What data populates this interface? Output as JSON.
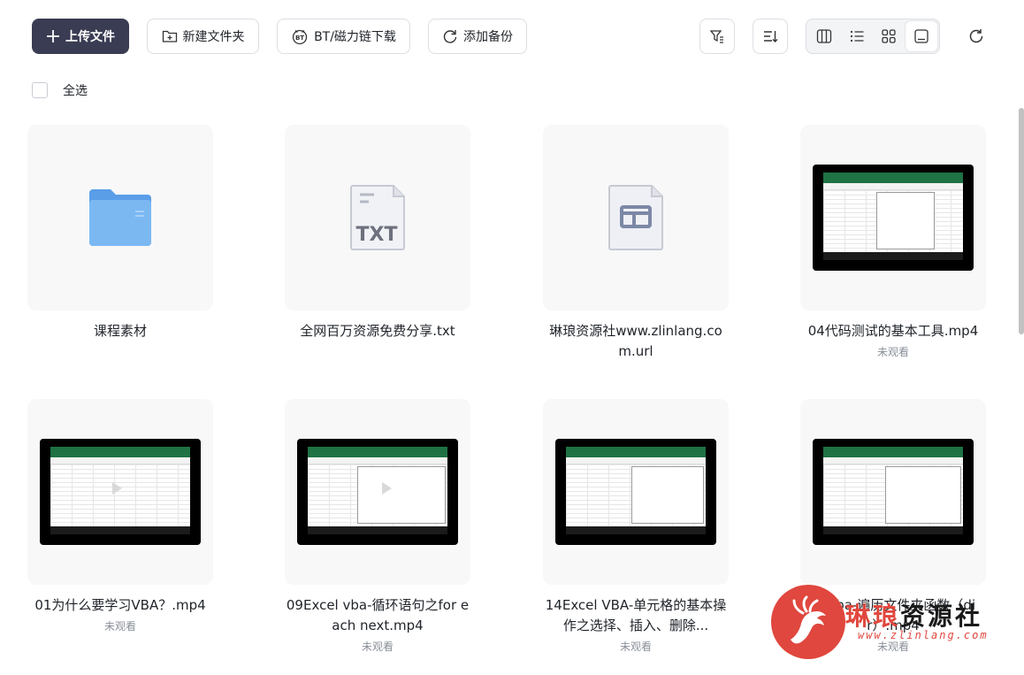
{
  "toolbar": {
    "upload_label": "上传文件",
    "new_folder_label": "新建文件夹",
    "bt_download_label": "BT/磁力链下载",
    "add_backup_label": "添加备份",
    "filter_icon": "filter-icon",
    "sort_icon": "sort-icon",
    "refresh_icon": "refresh-icon",
    "view_modes": [
      "columns-view",
      "list-view",
      "grid-view",
      "large-thumb-view"
    ],
    "active_view": "large-thumb-view"
  },
  "select_all_label": "全选",
  "files": [
    {
      "name": "课程素材",
      "type": "folder",
      "status": ""
    },
    {
      "name": "全网百万资源免费分享.txt",
      "type": "txt",
      "status": ""
    },
    {
      "name": "琳琅资源社www.zlinlang.com.url",
      "type": "url",
      "status": ""
    },
    {
      "name": "04代码测试的基本工具.mp4",
      "type": "video",
      "status": "未观看"
    },
    {
      "name": "01为什么要学习VBA？.mp4",
      "type": "video",
      "status": "未观看"
    },
    {
      "name": "09Excel vba-循环语句之for each next.mp4",
      "type": "video",
      "status": "未观看"
    },
    {
      "name": "14Excel VBA-单元格的基本操作之选择、插入、删除...",
      "type": "video",
      "status": "未观看"
    },
    {
      "name": "el Vba-遍历文件夹函数（dir）.mp4",
      "type": "video",
      "status": "未观看"
    }
  ],
  "txt_badge": "TXT",
  "watermark": {
    "text_red": "琳琅",
    "text_dark": "资源社",
    "url": "www.zlinlang.com"
  },
  "colors": {
    "primary": "#3a3c53",
    "folder": "#6aaef0",
    "watermark_red": "#e0473e"
  }
}
